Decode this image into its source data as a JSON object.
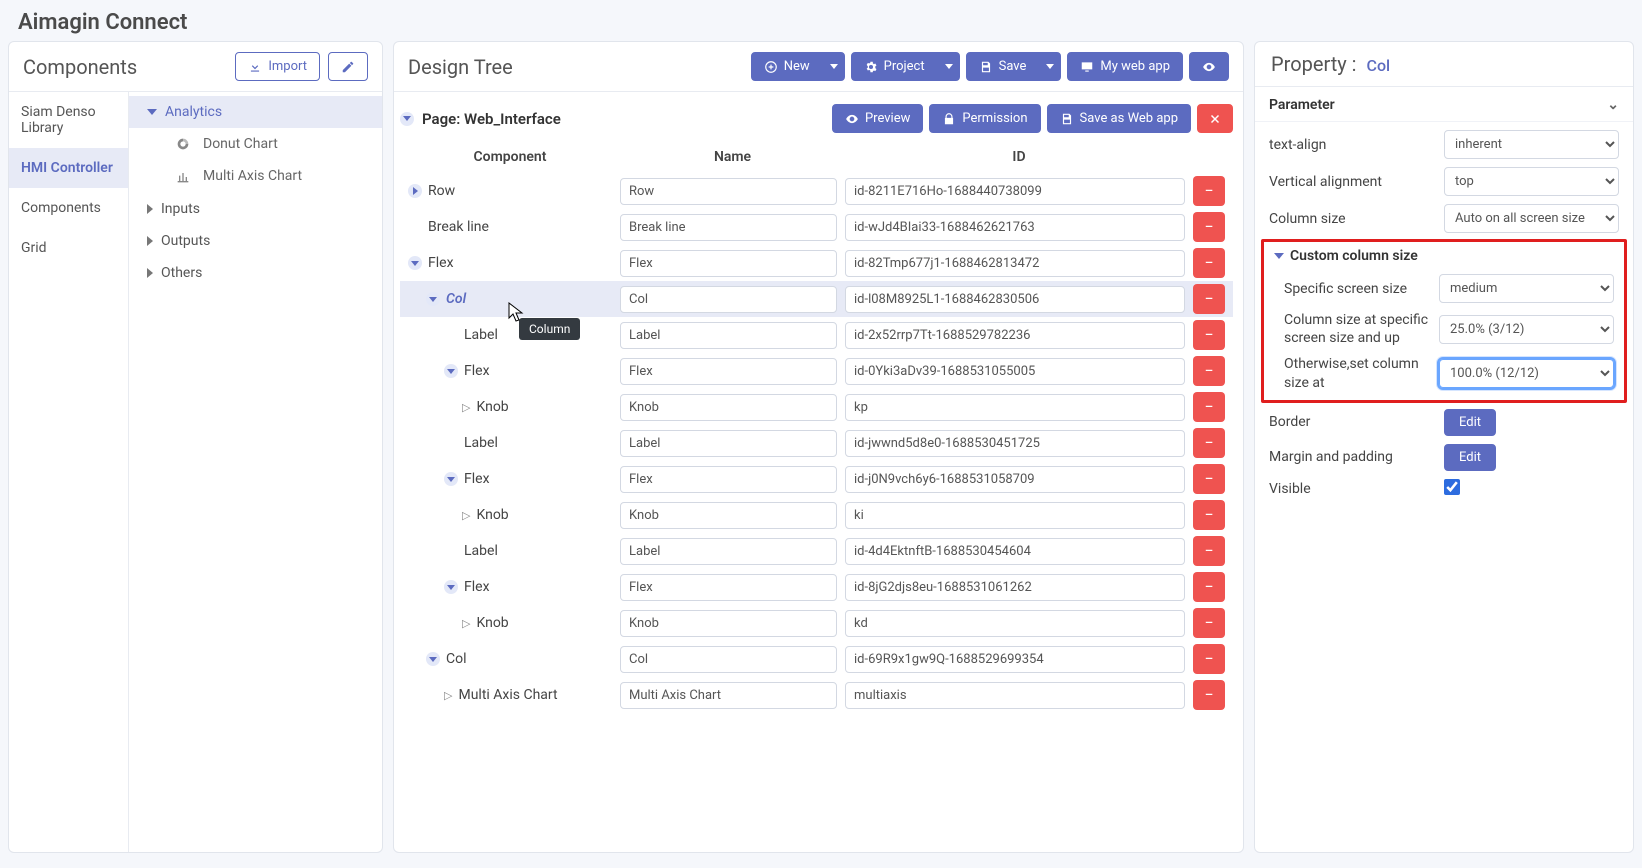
{
  "app_title": "Aimagin Connect",
  "components_panel": {
    "title": "Components",
    "import_label": "Import",
    "vtabs": [
      "Siam Denso Library",
      "HMI Controller",
      "Components",
      "Grid"
    ],
    "vtab_active": 1,
    "groups": [
      {
        "label": "Analytics",
        "open": true,
        "children": [
          {
            "icon": "donut",
            "label": "Donut Chart"
          },
          {
            "icon": "multiaxis",
            "label": "Multi Axis Chart"
          }
        ]
      },
      {
        "label": "Inputs",
        "open": false,
        "children": []
      },
      {
        "label": "Outputs",
        "open": false,
        "children": []
      },
      {
        "label": "Others",
        "open": false,
        "children": []
      }
    ]
  },
  "design_tree": {
    "title": "Design Tree",
    "toolbar": {
      "new": "New",
      "project": "Project",
      "save": "Save",
      "my_web_app": "My web app"
    },
    "page_label_prefix": "Page: ",
    "page_name": "Web_Interface",
    "page_bar": {
      "preview": "Preview",
      "permission": "Permission",
      "save_as": "Save as Web app"
    },
    "columns": {
      "component": "Component",
      "name": "Name",
      "id": "ID"
    },
    "rows": [
      {
        "indent": 0,
        "toggle": "closed",
        "label": "Row",
        "name": "Row",
        "id": "id-8211E716Ho-1688440738099",
        "selected": false,
        "leaf": false
      },
      {
        "indent": 0,
        "toggle": "none",
        "label": "Break line",
        "name": "Break line",
        "id": "id-wJd4BIai33-1688462621763",
        "selected": false,
        "leaf": true
      },
      {
        "indent": 0,
        "toggle": "open",
        "label": "Flex",
        "name": "Flex",
        "id": "id-82Tmp677j1-1688462813472",
        "selected": false,
        "leaf": false
      },
      {
        "indent": 1,
        "toggle": "open",
        "label": "Col",
        "name": "Col",
        "id": "id-l08M8925L1-1688462830506",
        "selected": true,
        "leaf": false
      },
      {
        "indent": 2,
        "toggle": "none",
        "label": "Label",
        "name": "Label",
        "id": "id-2x52rrp7Tt-1688529782236",
        "selected": false,
        "leaf": true
      },
      {
        "indent": 2,
        "toggle": "open",
        "label": "Flex",
        "name": "Flex",
        "id": "id-0Yki3aDv39-1688531055005",
        "selected": false,
        "leaf": false
      },
      {
        "indent": 3,
        "toggle": "leaf",
        "label": "Knob",
        "name": "Knob",
        "id": "kp",
        "selected": false,
        "leaf": true
      },
      {
        "indent": 2,
        "toggle": "none",
        "label": "Label",
        "name": "Label",
        "id": "id-jwwnd5d8e0-1688530451725",
        "selected": false,
        "leaf": true
      },
      {
        "indent": 2,
        "toggle": "open",
        "label": "Flex",
        "name": "Flex",
        "id": "id-j0N9vch6y6-1688531058709",
        "selected": false,
        "leaf": false
      },
      {
        "indent": 3,
        "toggle": "leaf",
        "label": "Knob",
        "name": "Knob",
        "id": "ki",
        "selected": false,
        "leaf": true
      },
      {
        "indent": 2,
        "toggle": "none",
        "label": "Label",
        "name": "Label",
        "id": "id-4d4EktnftB-1688530454604",
        "selected": false,
        "leaf": true
      },
      {
        "indent": 2,
        "toggle": "open",
        "label": "Flex",
        "name": "Flex",
        "id": "id-8jG2djs8eu-1688531061262",
        "selected": false,
        "leaf": false
      },
      {
        "indent": 3,
        "toggle": "leaf",
        "label": "Knob",
        "name": "Knob",
        "id": "kd",
        "selected": false,
        "leaf": true
      },
      {
        "indent": 1,
        "toggle": "open",
        "label": "Col",
        "name": "Col",
        "id": "id-69R9x1gw9Q-1688529699354",
        "selected": false,
        "leaf": false
      },
      {
        "indent": 2,
        "toggle": "leaf",
        "label": "Multi Axis Chart",
        "name": "Multi Axis Chart",
        "id": "multiaxis",
        "selected": false,
        "leaf": true
      }
    ],
    "tooltip": "Column"
  },
  "property_panel": {
    "title_prefix": "Property :",
    "for": "Col",
    "parameter_label": "Parameter",
    "rows": {
      "text_align": {
        "label": "text-align",
        "value": "inherent"
      },
      "valign": {
        "label": "Vertical alignment",
        "value": "top"
      },
      "colsize": {
        "label": "Column size",
        "value": "Auto on all screen size"
      }
    },
    "custom": {
      "heading": "Custom column size",
      "screen": {
        "label": "Specific screen size",
        "value": "medium"
      },
      "size_at": {
        "label": "Column size at specific screen size and up",
        "value": "25.0% (3/12)"
      },
      "otherwise": {
        "label": "Otherwise,set column size at",
        "value": "100.0% (12/12)"
      }
    },
    "border": {
      "label": "Border",
      "button": "Edit"
    },
    "margin": {
      "label": "Margin and padding",
      "button": "Edit"
    },
    "visible": {
      "label": "Visible",
      "checked": true
    }
  }
}
